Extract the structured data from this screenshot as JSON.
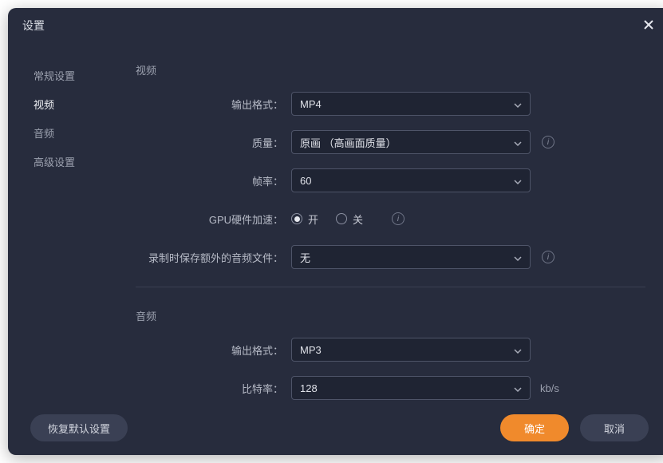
{
  "title": "设置",
  "sidebar": {
    "items": [
      {
        "label": "常规设置",
        "active": false
      },
      {
        "label": "视频",
        "active": true
      },
      {
        "label": "音频",
        "active": false
      },
      {
        "label": "高级设置",
        "active": false
      }
    ]
  },
  "video": {
    "section_title": "视频",
    "output_format": {
      "label": "输出格式：",
      "value": "MP4"
    },
    "quality": {
      "label": "质量：",
      "value": "原画 （高画面质量）"
    },
    "framerate": {
      "label": "帧率：",
      "value": "60"
    },
    "gpu_accel": {
      "label": "GPU硬件加速：",
      "on": "开",
      "off": "关",
      "selected": "on"
    },
    "extra_audio": {
      "label": "录制时保存额外的音频文件：",
      "value": "无"
    }
  },
  "audio": {
    "section_title": "音频",
    "output_format": {
      "label": "输出格式：",
      "value": "MP3"
    },
    "bitrate": {
      "label": "比特率：",
      "value": "128",
      "unit": "kb/s"
    }
  },
  "footer": {
    "restore": "恢复默认设置",
    "ok": "确定",
    "cancel": "取消"
  }
}
